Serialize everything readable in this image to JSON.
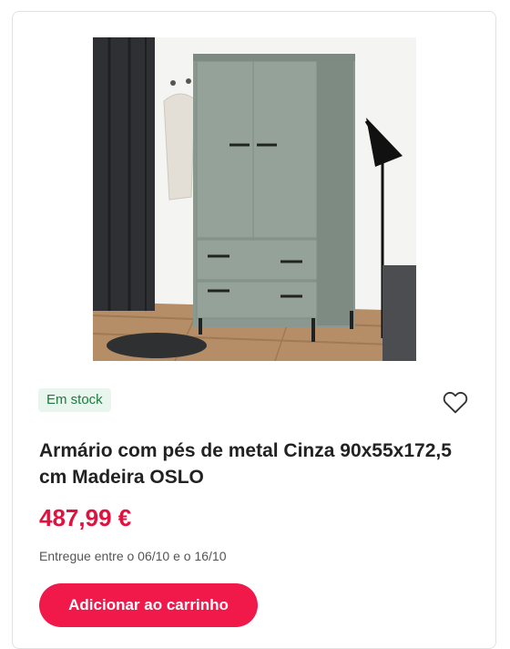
{
  "product": {
    "image_alt": "Armário com pés de metal Cinza 90x55x172,5 cm Madeira OSLO",
    "stock_label": "Em stock",
    "wishlist_icon": "heart-outline-icon",
    "title": "Armário com pés de metal Cinza 90x55x172,5 cm Madeira OSLO",
    "price": "487,99 €",
    "delivery": "Entregue entre o 06/10 e o 16/10",
    "cart_button_label": "Adicionar ao carrinho"
  },
  "colors": {
    "accent": "#f0194a",
    "price": "#e0123f",
    "stock_bg": "#e9f6ee",
    "stock_text": "#1f7a3f",
    "wardrobe": "#8a988f"
  }
}
